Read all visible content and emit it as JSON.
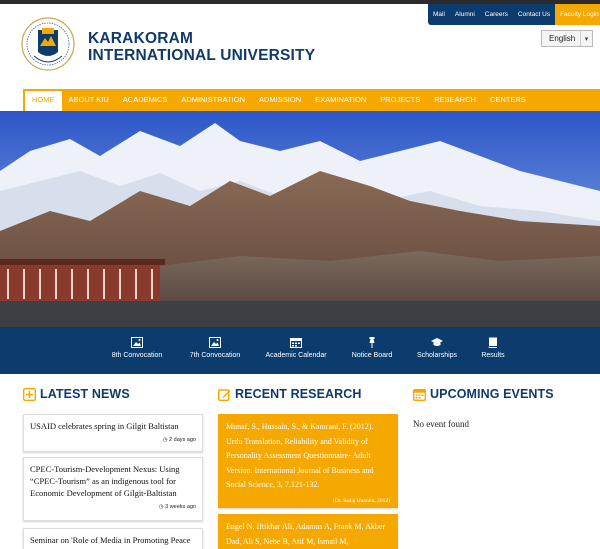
{
  "top_links": [
    "Mail",
    "Alumni",
    "Careers",
    "Contact Us",
    "Faculty Login"
  ],
  "brand": {
    "line1": "KARAKORAM",
    "line2": "INTERNATIONAL UNIVERSITY"
  },
  "language": {
    "selected": "English"
  },
  "nav": [
    "HOME",
    "ABOUT KIU",
    "ACADEMICS",
    "ADMINISTRATION",
    "ADMISSION",
    "EXAMINATION",
    "PROJECTS",
    "RESEARCH",
    "CENTERS"
  ],
  "quick_links": [
    {
      "label": "8th Convocation",
      "icon": "image-icon"
    },
    {
      "label": "7th Convocation",
      "icon": "image-icon"
    },
    {
      "label": "Academic Calendar",
      "icon": "calendar-icon"
    },
    {
      "label": "Notice Board",
      "icon": "pushpin-icon"
    },
    {
      "label": "Scholarships",
      "icon": "graduation-cap-icon"
    },
    {
      "label": "Results",
      "icon": "book-icon"
    }
  ],
  "sections": {
    "news": "LATEST NEWS",
    "research": "RECENT RESEARCH",
    "events": "UPCOMING EVENTS"
  },
  "news": [
    {
      "title": "USAID celebrates spring in Gilgit Baltistan",
      "meta": "2 days ago"
    },
    {
      "title": "CPEC-Tourism-Development Nexus: Using “CPEC-Tourism” as an indigenous tool for Economic Development of Gilgit-Baltistan",
      "meta": "3 weeks ago"
    },
    {
      "title": "Seminar on 'Role of Media in Promoting Peace",
      "meta": ""
    }
  ],
  "research": [
    {
      "text": "Munaf, S., Hussain, S., & Kamrani, F. (2012). Urdu Translation, Reliability and Validity of Personality Assessment Questionnaire- Adult Version. International Journal of Business and Social Science, 3, 7.121-132.",
      "meta": "(Dr. Sadaj Hussain, 2012)"
    },
    {
      "text": "Engel N, Iftikhar Ali, Adamus A, Frank M, Akber Dad, Ali S, Nebe B, Atif M, Ismail M,",
      "meta": ""
    }
  ],
  "events": {
    "empty_text": "No event found"
  },
  "colors": {
    "accent": "#f5a800",
    "brand_blue": "#0c3c6e",
    "title_blue": "#103a6b"
  }
}
